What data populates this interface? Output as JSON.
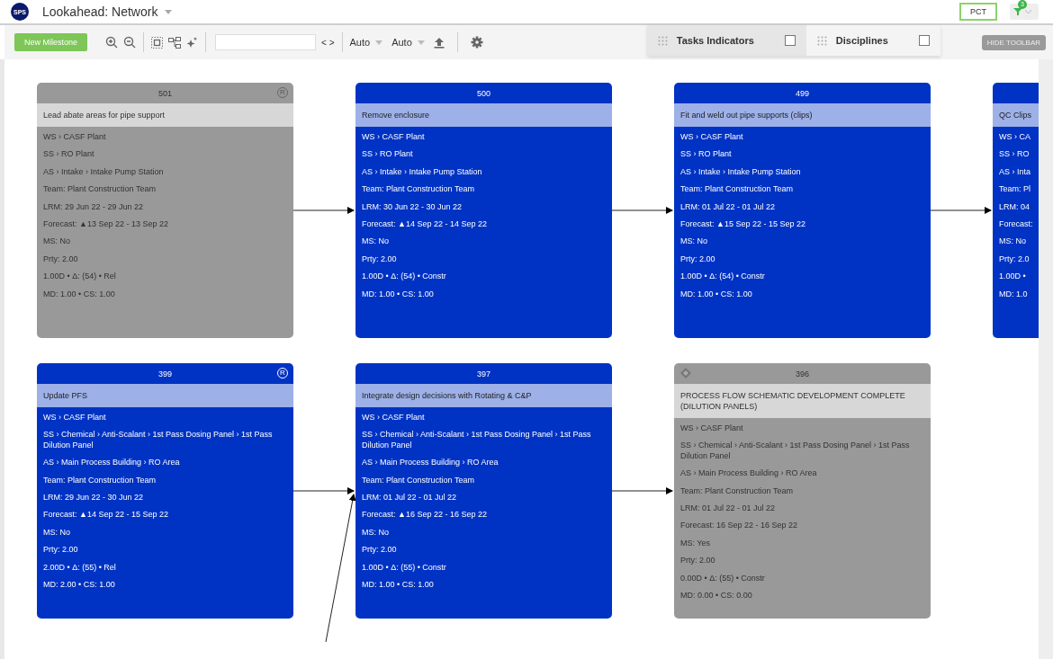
{
  "header": {
    "logo": "SPS",
    "title": "Lookahead: Network",
    "pct": "PCT",
    "filter_count": "3"
  },
  "toolbar": {
    "new_button": "New Milestone",
    "nav": "< >",
    "dropdowns": [
      "Auto",
      "Auto"
    ],
    "panel": [
      {
        "label": "Tasks Indicators",
        "checked": false
      },
      {
        "label": "Disciplines",
        "checked": false
      }
    ],
    "hide_button": "HIDE TOOLBAR"
  },
  "cards": [
    {
      "number": "501",
      "greyed": true,
      "badge": "R",
      "milestone": false,
      "arrow_from_below": false,
      "title": "Lead abate areas for pipe support",
      "lines": [
        "WS › CASF Plant",
        "SS › RO Plant",
        "AS › Intake › Intake Pump Station",
        "Team: Plant Construction Team",
        "LRM: 29 Jun 22 - 29 Jun 22",
        "Forecast: ▲13 Sep 22 - 13 Sep 22",
        "MS: No",
        "Prty: 2.00",
        "1.00D • Δ: (54) • Rel",
        "MD: 1.00 • CS: 1.00"
      ]
    },
    {
      "number": "500",
      "greyed": false,
      "milestone": false,
      "arrow_in": true,
      "arrow_from_below": false,
      "title": "Remove enclosure",
      "lines": [
        "WS › CASF Plant",
        "SS › RO Plant",
        "AS › Intake › Intake Pump Station",
        "Team: Plant Construction Team",
        "LRM: 30 Jun 22 - 30 Jun 22",
        "Forecast: ▲14 Sep 22 - 14 Sep 22",
        "MS: No",
        "Prty: 2.00",
        "1.00D • Δ: (54) • Constr",
        "MD: 1.00 • CS: 1.00"
      ]
    },
    {
      "number": "499",
      "greyed": false,
      "milestone": false,
      "arrow_in": true,
      "arrow_from_below": false,
      "title": "Fit and weld out pipe supports (clips)",
      "lines": [
        "WS › CASF Plant",
        "SS › RO Plant",
        "AS › Intake › Intake Pump Station",
        "Team: Plant Construction Team",
        "LRM: 01 Jul 22 - 01 Jul 22",
        "Forecast: ▲15 Sep 22 - 15 Sep 22",
        "MS: No",
        "Prty: 2.00",
        "1.00D • Δ: (54) • Constr",
        "MD: 1.00 • CS: 1.00"
      ]
    },
    {
      "greyed": false,
      "milestone": false,
      "arrow_in": true,
      "arrow_from_below": false,
      "title": "QC Clips",
      "lines": [
        "WS › CA",
        "SS › RO",
        "AS › Inta",
        "Team: Pl",
        "LRM: 04",
        "Forecast:",
        "MS: No",
        "Prty: 2.0",
        "1.00D •",
        "MD: 1.0"
      ]
    },
    {
      "number": "399",
      "greyed": false,
      "badge": "R",
      "milestone": false,
      "arrow_from_below": false,
      "title": "Update PFS",
      "lines": [
        "WS › CASF Plant",
        "SS › Chemical › Anti-Scalant › 1st Pass Dosing Panel › 1st Pass Dilution Panel",
        "AS › Main Process Building › RO Area",
        "Team: Plant Construction Team",
        "LRM: 29 Jun 22 - 30 Jun 22",
        "Forecast: ▲14 Sep 22 - 15 Sep 22",
        "MS: No",
        "Prty: 2.00",
        "2.00D • Δ: (55) • Rel",
        "MD: 2.00 • CS: 1.00"
      ]
    },
    {
      "number": "397",
      "greyed": false,
      "milestone": false,
      "arrow_in": true,
      "arrow_from_below": true,
      "title": "Integrate design decisions with Rotating & C&P",
      "lines": [
        "WS › CASF Plant",
        "SS › Chemical › Anti-Scalant › 1st Pass Dosing Panel › 1st Pass Dilution Panel",
        "AS › Main Process Building › RO Area",
        "Team: Plant Construction Team",
        "LRM: 01 Jul 22 - 01 Jul 22",
        "Forecast: ▲16 Sep 22 - 16 Sep 22",
        "MS: No",
        "Prty: 2.00",
        "1.00D • Δ: (55) • Constr",
        "MD: 1.00 • CS: 1.00"
      ]
    },
    {
      "number": "396",
      "greyed": true,
      "milestone": true,
      "arrow_in": true,
      "arrow_from_below": false,
      "title": "PROCESS FLOW SCHEMATIC DEVELOPMENT COMPLETE (DILUTION PANELS)",
      "lines": [
        "WS › CASF Plant",
        "SS › Chemical › Anti-Scalant › 1st Pass Dosing Panel › 1st Pass Dilution Panel",
        "AS › Main Process Building › RO Area",
        "Team: Plant Construction Team",
        "LRM: 01 Jul 22 - 01 Jul 22",
        "Forecast: 16 Sep 22 - 16 Sep 22",
        "MS: Yes",
        "Prty: 2.00",
        "0.00D • Δ: (55) • Constr",
        "MD: 0.00 • CS: 0.00"
      ]
    }
  ]
}
